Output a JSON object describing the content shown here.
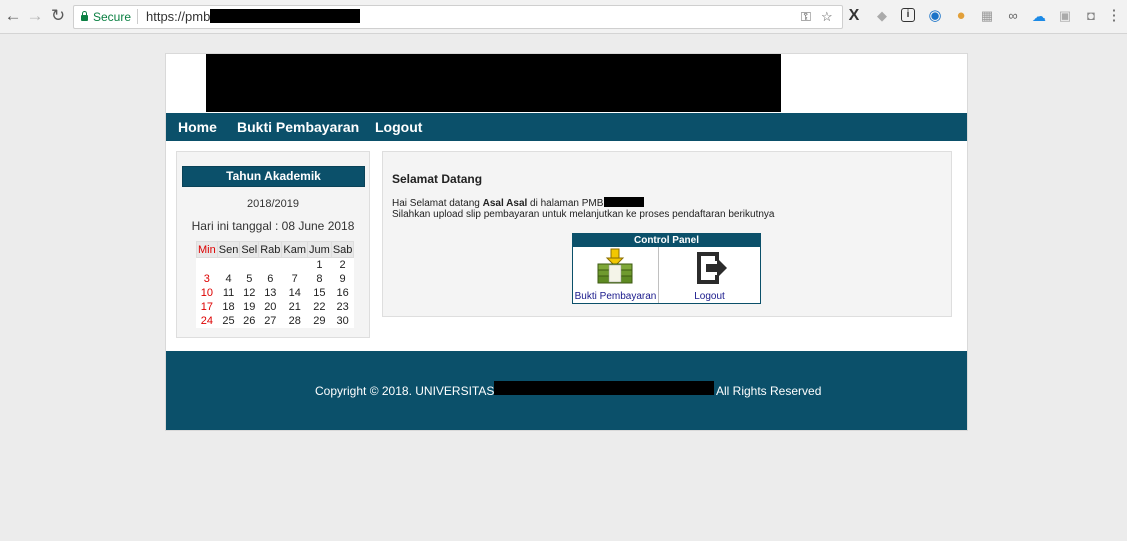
{
  "browser": {
    "back_icon": "arrow-left-icon",
    "forward_icon": "arrow-right-icon",
    "reload_icon": "reload-icon",
    "secure_label": "Secure",
    "url": "https://pmb.",
    "extensions": [
      "key-icon",
      "star-icon",
      "x-icon",
      "puzzle-icon",
      "info-icon",
      "eye-icon",
      "cookie-icon",
      "grid-icon",
      "link-icon",
      "cloud-icon",
      "save-icon",
      "gray-icon",
      "kebab-menu-icon"
    ]
  },
  "nav": {
    "home": "Home",
    "bukti": "Bukti Pembayaran",
    "logout": "Logout"
  },
  "sidebar": {
    "title": "Tahun Akademik",
    "year": "2018/2019",
    "today": "Hari ini tanggal : 08 June 2018",
    "calendar": {
      "days": [
        "Min",
        "Sen",
        "Sel",
        "Rab",
        "Kam",
        "Jum",
        "Sab"
      ],
      "weeks": [
        [
          "",
          "",
          "",
          "",
          "",
          "1",
          "2"
        ],
        [
          "3",
          "4",
          "5",
          "6",
          "7",
          "8",
          "9"
        ],
        [
          "10",
          "11",
          "12",
          "13",
          "14",
          "15",
          "16"
        ],
        [
          "17",
          "18",
          "19",
          "20",
          "21",
          "22",
          "23"
        ],
        [
          "24",
          "25",
          "26",
          "27",
          "28",
          "29",
          "30"
        ]
      ]
    }
  },
  "main": {
    "title": "Selamat Datang",
    "line1_prefix": "Hai Selamat datang ",
    "user_name": "Asal Asal",
    "line1_suffix": " di halaman PMB",
    "line2": "Silahkan upload slip pembayaran untuk melanjutkan ke proses pendaftaran berikutnya",
    "control_panel": {
      "title": "Control Panel",
      "items": [
        {
          "label": "Bukti Pembayaran",
          "icon": "money-stack-icon"
        },
        {
          "label": "Logout",
          "icon": "logout-icon"
        }
      ]
    }
  },
  "footer": {
    "copyright": "Copyright © 2018. UNIVERSITAS",
    "rights": "All Rights Reserved"
  },
  "colors": {
    "brand": "#0b506a",
    "sunday": "#dd0000",
    "link": "#1a1a8c"
  }
}
